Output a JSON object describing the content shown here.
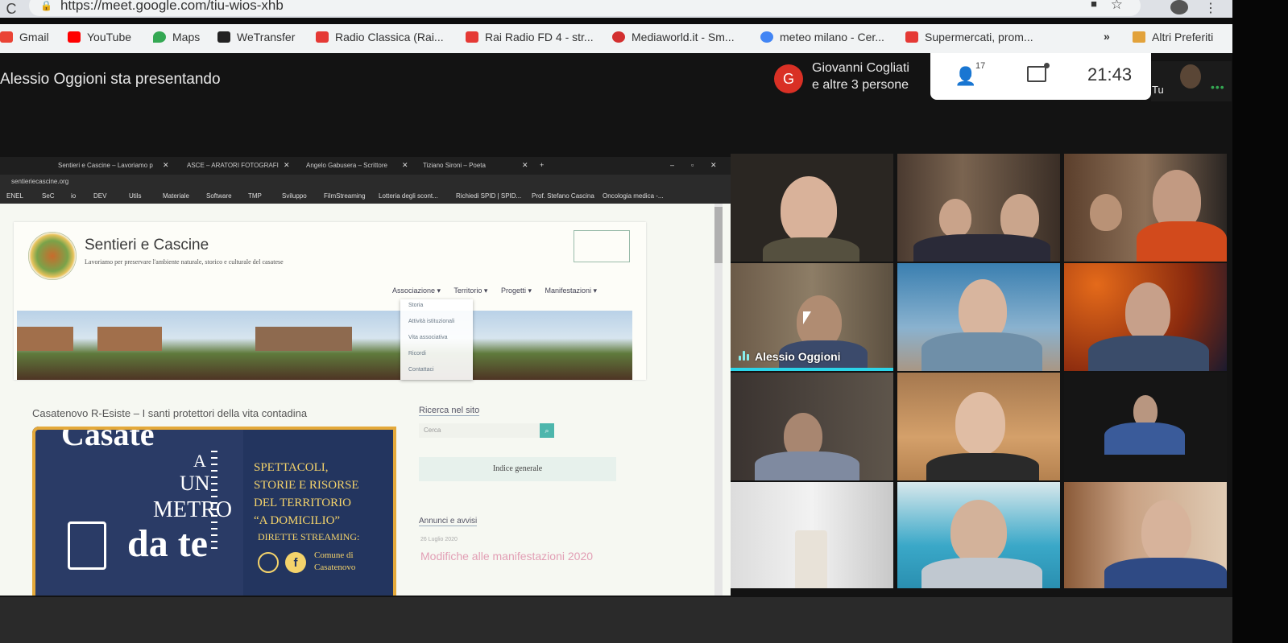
{
  "browser": {
    "url": "https://meet.google.com/tiu-wios-xhb",
    "bookmarks": [
      {
        "label": "Gmail",
        "color": "#ea4335"
      },
      {
        "label": "YouTube",
        "color": "#ff0000"
      },
      {
        "label": "Maps",
        "color": "#34a853"
      },
      {
        "label": "WeTransfer",
        "color": "#222222"
      },
      {
        "label": "Radio Classica (Rai...",
        "color": "#e53935"
      },
      {
        "label": "Rai Radio FD 4 - str...",
        "color": "#e53935"
      },
      {
        "label": "Mediaworld.it - Sm...",
        "color": "#d32f2f"
      },
      {
        "label": "meteo milano - Cer...",
        "color": "#4285f4"
      },
      {
        "label": "Supermercati, prom...",
        "color": "#e53935"
      }
    ],
    "more": "»",
    "other_bookmarks": "Altri Preferiti"
  },
  "meet": {
    "presenting": "Alessio Oggioni sta presentando",
    "joiner_avatar": "G",
    "joiner_line1": "Giovanni Cogliati",
    "joiner_line2": "e altre 3 persone",
    "people_count": "17",
    "time": "21:43",
    "self_label": "Tu",
    "active_speaker": "Alessio Oggioni",
    "accent": "#2bd4e8"
  },
  "shared_screen": {
    "tabs": [
      "Sentieri e Cascine – Lavoriamo p",
      "ASCE – ARATORI FOTOGRAFI",
      "Angelo Gabusera – Scrittore",
      "Tiziano Sironi – Poeta"
    ],
    "url": "sentieriecascine.org",
    "bookmarks": [
      "ENEL",
      "SeC",
      "io",
      "DEV",
      "Utils",
      "Materiale",
      "Software",
      "TMP",
      "Sviluppo",
      "FilmStreaming",
      "Lotteria degli scont...",
      "Richiedi SPID | SPID...",
      "Prof. Stefano Cascina",
      "Oncologia medica -..."
    ],
    "site": {
      "title": "Sentieri e Cascine",
      "subtitle": "Lavoriamo per preservare l'ambiente naturale, storico e culturale del casatese",
      "nav": [
        "Associazione ▾",
        "Territorio ▾",
        "Progetti ▾",
        "Manifestazioni ▾"
      ],
      "dropdown": [
        "Storia",
        "Attività istituzionali",
        "Vita associativa",
        "Ricordi",
        "Contattaci"
      ],
      "article_title": "Casatenovo R-Esiste – I santi protettori della vita contadina",
      "poster": {
        "big": "Casate",
        "a": "A",
        "un": "UN",
        "metro": "METRO",
        "data_te": "da te",
        "right_lines": [
          "SPETTACOLI,",
          "STORIE E RISORSE",
          "DEL TERRITORIO",
          "“A DOMICILIO”"
        ],
        "dirette": "DIRETTE STREAMING:",
        "comune_l1": "Comune di",
        "comune_l2": "Casatenovo"
      },
      "search_title": "Ricerca nel sito",
      "search_placeholder": "Cerca",
      "indice": "Indice generale",
      "annunci": "Annunci e avvisi",
      "annunci_date": "26 Luglio 2020",
      "annunci_link": "Modifiche alle manifestazioni 2020"
    }
  }
}
